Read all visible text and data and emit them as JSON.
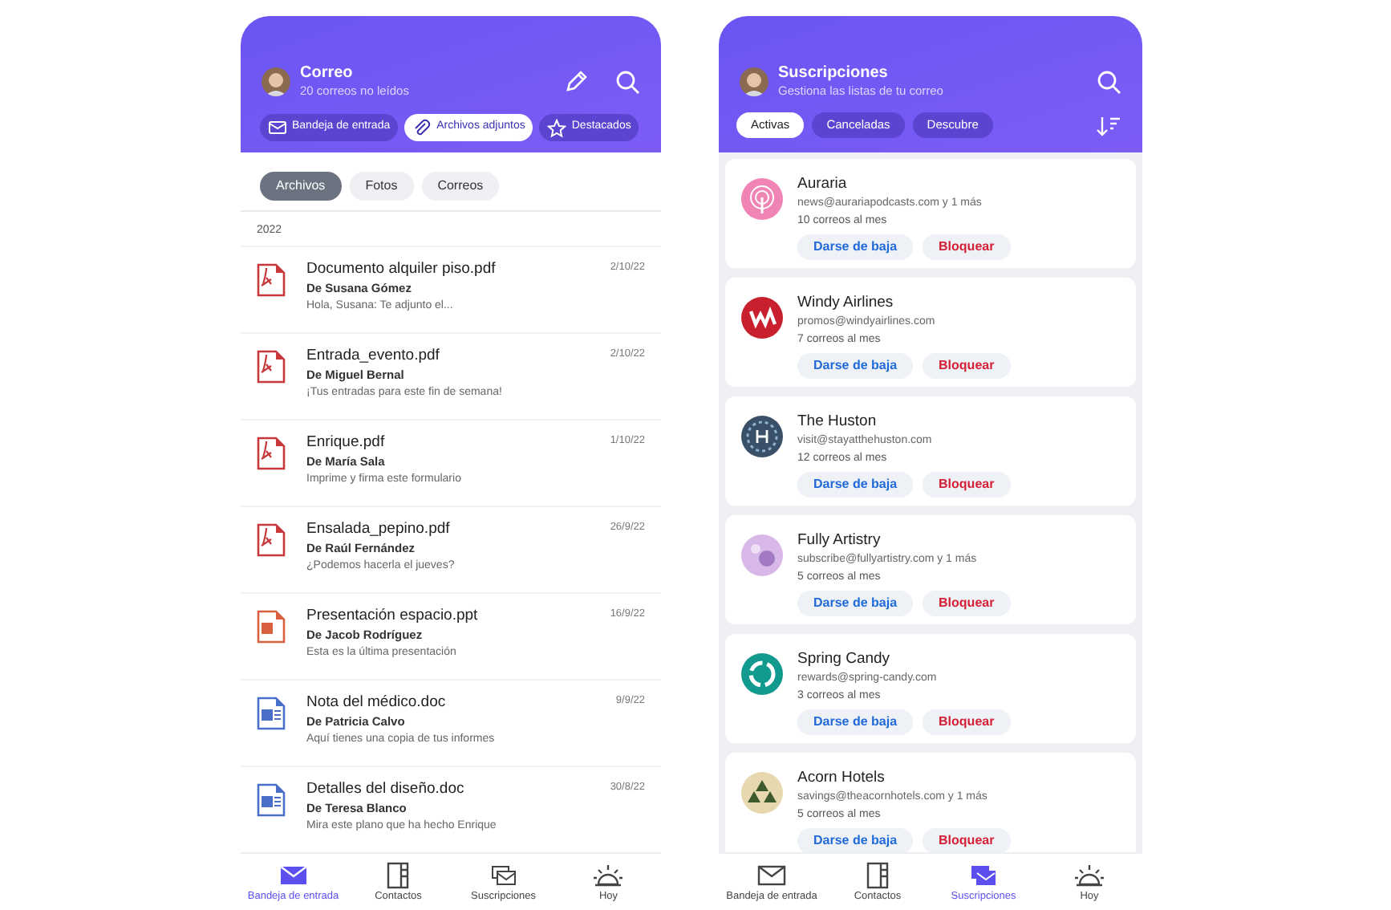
{
  "left_screen": {
    "header": {
      "title": "Correo",
      "subtitle": "20 correos no leídos"
    },
    "tabs": [
      {
        "label": "Bandeja de entrada",
        "selected": false
      },
      {
        "label": "Archivos adjuntos",
        "selected": true
      },
      {
        "label": "Destacados",
        "selected": false
      }
    ],
    "filters": [
      {
        "label": "Archivos",
        "selected": true
      },
      {
        "label": "Fotos",
        "selected": false
      },
      {
        "label": "Correos",
        "selected": false
      }
    ],
    "section": "2022",
    "files": [
      {
        "kind": "pdf",
        "name": "Documento alquiler piso.pdf",
        "sender": "De Susana Gómez",
        "preview": "Hola, Susana: Te adjunto el...",
        "date": "2/10/22"
      },
      {
        "kind": "pdf",
        "name": "Entrada_evento.pdf",
        "sender": "De Miguel Bernal",
        "preview": "¡Tus entradas para este fin de semana!",
        "date": "2/10/22"
      },
      {
        "kind": "pdf",
        "name": "Enrique.pdf",
        "sender": "De María Sala",
        "preview": "Imprime y firma este formulario",
        "date": "1/10/22"
      },
      {
        "kind": "pdf",
        "name": "Ensalada_pepino.pdf",
        "sender": "De Raúl Fernández",
        "preview": "¿Podemos hacerla el jueves?",
        "date": "26/9/22"
      },
      {
        "kind": "ppt",
        "name": "Presentación espacio.ppt",
        "sender": "De Jacob Rodríguez",
        "preview": "Esta es la última presentación",
        "date": "16/9/22"
      },
      {
        "kind": "doc",
        "name": "Nota del médico.doc",
        "sender": "De Patricia Calvo",
        "preview": "Aquí tienes una copia de tus informes",
        "date": "9/9/22"
      },
      {
        "kind": "doc",
        "name": "Detalles del diseño.doc",
        "sender": "De Teresa Blanco",
        "preview": "Mira este plano que ha hecho Enrique",
        "date": "30/8/22"
      }
    ],
    "nav": [
      {
        "label": "Bandeja de entrada",
        "selected": true
      },
      {
        "label": "Contactos",
        "selected": false
      },
      {
        "label": "Suscripciones",
        "selected": false
      },
      {
        "label": "Hoy",
        "selected": false
      }
    ]
  },
  "right_screen": {
    "header": {
      "title": "Suscripciones",
      "subtitle": "Gestiona las listas de tu correo"
    },
    "tabs": [
      {
        "label": "Activas",
        "selected": true
      },
      {
        "label": "Canceladas",
        "selected": false
      },
      {
        "label": "Descubre",
        "selected": false
      }
    ],
    "subscriptions": [
      {
        "color": "#f084b4",
        "name": "Auraria",
        "email": "news@aurariapodcasts.com y 1 más",
        "frequency": "10 correos al mes",
        "unsubscribe": "Darse de baja",
        "block": "Bloquear"
      },
      {
        "color": "#c8202c",
        "name": "Windy Airlines",
        "email": "promos@windyairlines.com",
        "frequency": "7 correos al mes",
        "unsubscribe": "Darse de baja",
        "block": "Bloquear"
      },
      {
        "color": "#3a5068",
        "name": "The Huston",
        "email": "visit@stayatthehuston.com",
        "frequency": "12 correos al mes",
        "unsubscribe": "Darse de baja",
        "block": "Bloquear"
      },
      {
        "color": "#d8b8e8",
        "name": "Fully Artistry",
        "email": "subscribe@fullyartistry.com y 1 más",
        "frequency": "5 correos al mes",
        "unsubscribe": "Darse de baja",
        "block": "Bloquear"
      },
      {
        "color": "#139a8e",
        "name": "Spring Candy",
        "email": "rewards@spring-candy.com",
        "frequency": "3 correos al mes",
        "unsubscribe": "Darse de baja",
        "block": "Bloquear"
      },
      {
        "color": "#e8d8b0",
        "name": "Acorn Hotels",
        "email": "savings@theacornhotels.com y 1 más",
        "frequency": "5 correos al mes",
        "unsubscribe": "Darse de baja",
        "block": "Bloquear"
      }
    ],
    "nav": [
      {
        "label": "Bandeja de entrada",
        "selected": false
      },
      {
        "label": "Contactos",
        "selected": false
      },
      {
        "label": "Suscripciones",
        "selected": true
      },
      {
        "label": "Hoy",
        "selected": false
      }
    ]
  }
}
